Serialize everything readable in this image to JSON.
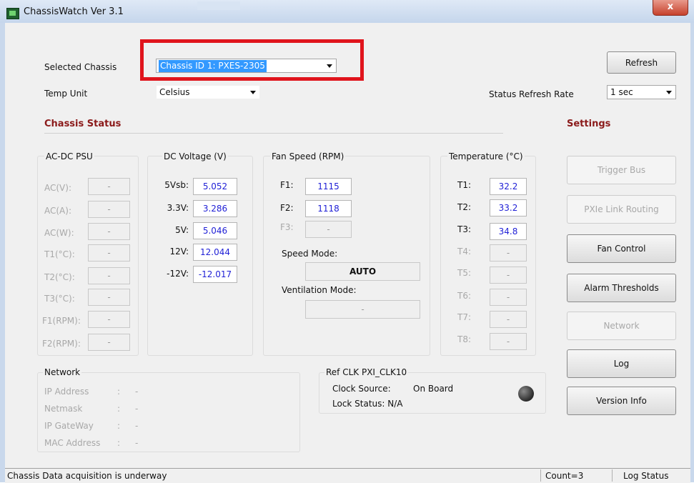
{
  "window": {
    "title": "ChassisWatch Ver 3.1",
    "close_glyph": "x"
  },
  "selected_chassis": {
    "label": "Selected Chassis",
    "value": "Chassis ID 1: PXES-2305"
  },
  "temp_unit": {
    "label": "Temp Unit",
    "value": "Celsius"
  },
  "refresh_button": "Refresh",
  "status_refresh_rate": {
    "label": "Status Refresh Rate",
    "value": "1 sec"
  },
  "chassis_status_heading": "Chassis Status",
  "settings_heading": "Settings",
  "psu": {
    "title": "AC-DC PSU",
    "rows": [
      {
        "label": "AC(V):",
        "value": "-"
      },
      {
        "label": "AC(A):",
        "value": "-"
      },
      {
        "label": "AC(W):",
        "value": "-"
      },
      {
        "label": "T1(°C):",
        "value": "-"
      },
      {
        "label": "T2(°C):",
        "value": "-"
      },
      {
        "label": "T3(°C):",
        "value": "-"
      },
      {
        "label": "F1(RPM):",
        "value": "-"
      },
      {
        "label": "F2(RPM):",
        "value": "-"
      }
    ]
  },
  "dc_voltage": {
    "title": "DC Voltage (V)",
    "rows": [
      {
        "label": "5Vsb:",
        "value": "5.052"
      },
      {
        "label": "3.3V:",
        "value": "3.286"
      },
      {
        "label": "5V:",
        "value": "5.046"
      },
      {
        "label": "12V:",
        "value": "12.044"
      },
      {
        "label": "-12V:",
        "value": "-12.017"
      }
    ]
  },
  "fan_speed": {
    "title": "Fan Speed (RPM)",
    "rows": [
      {
        "label": "F1:",
        "value": "1115"
      },
      {
        "label": "F2:",
        "value": "1118"
      },
      {
        "label": "F3:",
        "value": "-"
      }
    ],
    "speed_mode_label": "Speed Mode:",
    "speed_mode_value": "AUTO",
    "ventilation_mode_label": "Ventilation Mode:",
    "ventilation_mode_value": "-"
  },
  "temperature": {
    "title": "Temperature (°C)",
    "rows": [
      {
        "label": "T1:",
        "value": "32.2"
      },
      {
        "label": "T2:",
        "value": "33.2"
      },
      {
        "label": "T3:",
        "value": "34.8"
      },
      {
        "label": "T4:",
        "value": "-"
      },
      {
        "label": "T5:",
        "value": "-"
      },
      {
        "label": "T6:",
        "value": "-"
      },
      {
        "label": "T7:",
        "value": "-"
      },
      {
        "label": "T8:",
        "value": "-"
      }
    ]
  },
  "network": {
    "title": "Network",
    "rows": [
      {
        "label": "IP Address",
        "value": "-"
      },
      {
        "label": "Netmask",
        "value": "-"
      },
      {
        "label": "IP GateWay",
        "value": "-"
      },
      {
        "label": "MAC Address",
        "value": "-"
      }
    ],
    "separator": ":"
  },
  "ref_clk": {
    "title": "Ref CLK PXI_CLK10",
    "clock_source_label": "Clock Source:",
    "clock_source_value": "On Board",
    "lock_status": "Lock Status: N/A"
  },
  "settings_buttons": [
    {
      "label": "Trigger Bus",
      "enabled": false
    },
    {
      "label": "PXIe Link Routing",
      "enabled": false
    },
    {
      "label": "Fan Control",
      "enabled": true
    },
    {
      "label": "Alarm Thresholds",
      "enabled": true
    },
    {
      "label": "Network",
      "enabled": false
    },
    {
      "label": "Log",
      "enabled": true
    },
    {
      "label": "Version Info",
      "enabled": true
    }
  ],
  "status_bar": {
    "message": "Chassis Data acquisition is underway",
    "count": "Count=3",
    "log_status": "Log Status"
  },
  "colors": {
    "highlight": "#e0141c",
    "heading": "#8b1a1a",
    "value_text": "#1f1fd6",
    "selection": "#3399ff"
  }
}
